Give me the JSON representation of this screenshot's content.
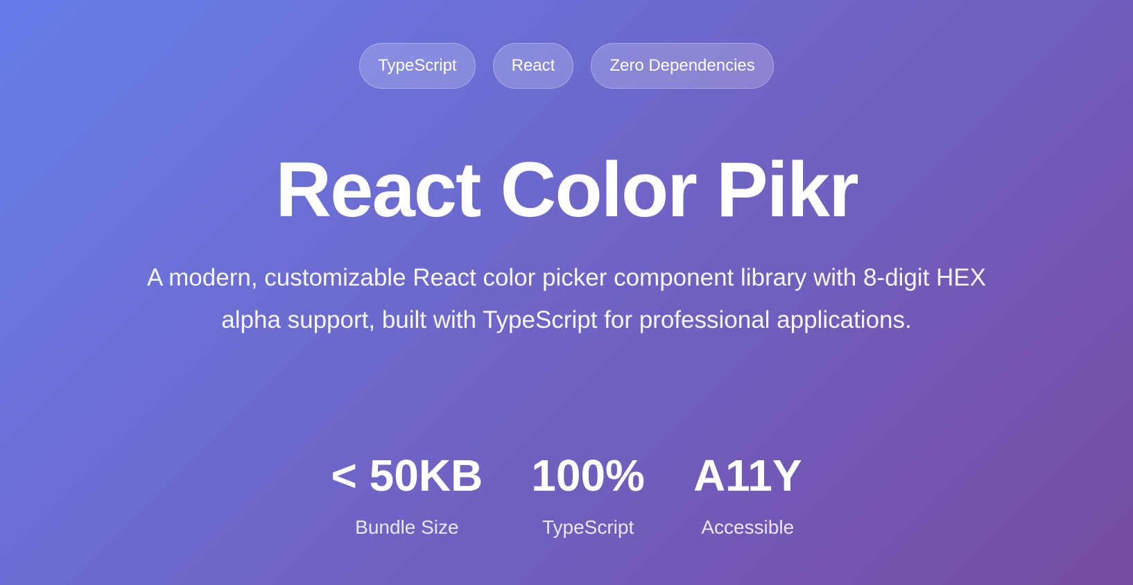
{
  "badges": [
    {
      "label": "TypeScript"
    },
    {
      "label": "React"
    },
    {
      "label": "Zero Dependencies"
    }
  ],
  "hero": {
    "title": "React Color Pikr",
    "description": "A modern, customizable React color picker component library with 8-digit HEX alpha support, built with TypeScript for professional applications."
  },
  "stats": [
    {
      "value": "< 50KB",
      "label": "Bundle Size"
    },
    {
      "value": "100%",
      "label": "TypeScript"
    },
    {
      "value": "A11Y",
      "label": "Accessible"
    }
  ],
  "colors": {
    "gradient_start": "#667eea",
    "gradient_end": "#764ba2",
    "text": "#ffffff"
  }
}
